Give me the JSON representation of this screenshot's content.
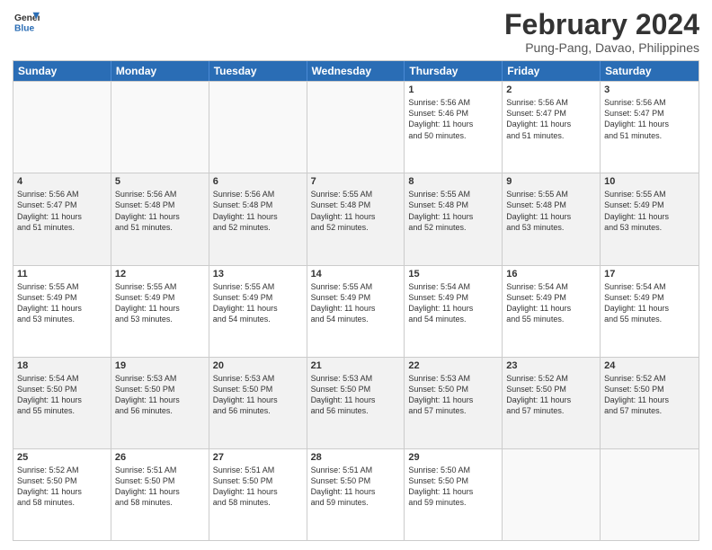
{
  "header": {
    "logo": {
      "line1": "General",
      "line2": "Blue"
    },
    "title": "February 2024",
    "location": "Pung-Pang, Davao, Philippines"
  },
  "weekdays": [
    "Sunday",
    "Monday",
    "Tuesday",
    "Wednesday",
    "Thursday",
    "Friday",
    "Saturday"
  ],
  "rows": [
    [
      {
        "day": "",
        "info": ""
      },
      {
        "day": "",
        "info": ""
      },
      {
        "day": "",
        "info": ""
      },
      {
        "day": "",
        "info": ""
      },
      {
        "day": "1",
        "info": "Sunrise: 5:56 AM\nSunset: 5:46 PM\nDaylight: 11 hours\nand 50 minutes."
      },
      {
        "day": "2",
        "info": "Sunrise: 5:56 AM\nSunset: 5:47 PM\nDaylight: 11 hours\nand 51 minutes."
      },
      {
        "day": "3",
        "info": "Sunrise: 5:56 AM\nSunset: 5:47 PM\nDaylight: 11 hours\nand 51 minutes."
      }
    ],
    [
      {
        "day": "4",
        "info": "Sunrise: 5:56 AM\nSunset: 5:47 PM\nDaylight: 11 hours\nand 51 minutes."
      },
      {
        "day": "5",
        "info": "Sunrise: 5:56 AM\nSunset: 5:48 PM\nDaylight: 11 hours\nand 51 minutes."
      },
      {
        "day": "6",
        "info": "Sunrise: 5:56 AM\nSunset: 5:48 PM\nDaylight: 11 hours\nand 52 minutes."
      },
      {
        "day": "7",
        "info": "Sunrise: 5:55 AM\nSunset: 5:48 PM\nDaylight: 11 hours\nand 52 minutes."
      },
      {
        "day": "8",
        "info": "Sunrise: 5:55 AM\nSunset: 5:48 PM\nDaylight: 11 hours\nand 52 minutes."
      },
      {
        "day": "9",
        "info": "Sunrise: 5:55 AM\nSunset: 5:48 PM\nDaylight: 11 hours\nand 53 minutes."
      },
      {
        "day": "10",
        "info": "Sunrise: 5:55 AM\nSunset: 5:49 PM\nDaylight: 11 hours\nand 53 minutes."
      }
    ],
    [
      {
        "day": "11",
        "info": "Sunrise: 5:55 AM\nSunset: 5:49 PM\nDaylight: 11 hours\nand 53 minutes."
      },
      {
        "day": "12",
        "info": "Sunrise: 5:55 AM\nSunset: 5:49 PM\nDaylight: 11 hours\nand 53 minutes."
      },
      {
        "day": "13",
        "info": "Sunrise: 5:55 AM\nSunset: 5:49 PM\nDaylight: 11 hours\nand 54 minutes."
      },
      {
        "day": "14",
        "info": "Sunrise: 5:55 AM\nSunset: 5:49 PM\nDaylight: 11 hours\nand 54 minutes."
      },
      {
        "day": "15",
        "info": "Sunrise: 5:54 AM\nSunset: 5:49 PM\nDaylight: 11 hours\nand 54 minutes."
      },
      {
        "day": "16",
        "info": "Sunrise: 5:54 AM\nSunset: 5:49 PM\nDaylight: 11 hours\nand 55 minutes."
      },
      {
        "day": "17",
        "info": "Sunrise: 5:54 AM\nSunset: 5:49 PM\nDaylight: 11 hours\nand 55 minutes."
      }
    ],
    [
      {
        "day": "18",
        "info": "Sunrise: 5:54 AM\nSunset: 5:50 PM\nDaylight: 11 hours\nand 55 minutes."
      },
      {
        "day": "19",
        "info": "Sunrise: 5:53 AM\nSunset: 5:50 PM\nDaylight: 11 hours\nand 56 minutes."
      },
      {
        "day": "20",
        "info": "Sunrise: 5:53 AM\nSunset: 5:50 PM\nDaylight: 11 hours\nand 56 minutes."
      },
      {
        "day": "21",
        "info": "Sunrise: 5:53 AM\nSunset: 5:50 PM\nDaylight: 11 hours\nand 56 minutes."
      },
      {
        "day": "22",
        "info": "Sunrise: 5:53 AM\nSunset: 5:50 PM\nDaylight: 11 hours\nand 57 minutes."
      },
      {
        "day": "23",
        "info": "Sunrise: 5:52 AM\nSunset: 5:50 PM\nDaylight: 11 hours\nand 57 minutes."
      },
      {
        "day": "24",
        "info": "Sunrise: 5:52 AM\nSunset: 5:50 PM\nDaylight: 11 hours\nand 57 minutes."
      }
    ],
    [
      {
        "day": "25",
        "info": "Sunrise: 5:52 AM\nSunset: 5:50 PM\nDaylight: 11 hours\nand 58 minutes."
      },
      {
        "day": "26",
        "info": "Sunrise: 5:51 AM\nSunset: 5:50 PM\nDaylight: 11 hours\nand 58 minutes."
      },
      {
        "day": "27",
        "info": "Sunrise: 5:51 AM\nSunset: 5:50 PM\nDaylight: 11 hours\nand 58 minutes."
      },
      {
        "day": "28",
        "info": "Sunrise: 5:51 AM\nSunset: 5:50 PM\nDaylight: 11 hours\nand 59 minutes."
      },
      {
        "day": "29",
        "info": "Sunrise: 5:50 AM\nSunset: 5:50 PM\nDaylight: 11 hours\nand 59 minutes."
      },
      {
        "day": "",
        "info": ""
      },
      {
        "day": "",
        "info": ""
      }
    ]
  ]
}
